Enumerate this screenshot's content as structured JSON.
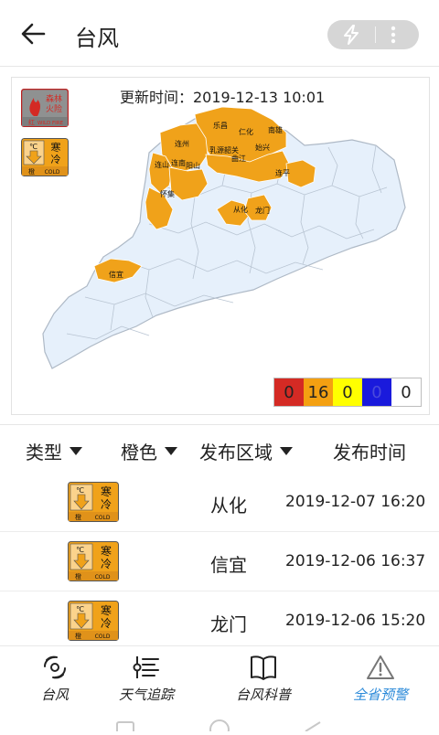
{
  "header": {
    "title": "台风"
  },
  "map": {
    "update_label": "更新时间：2019-12-13 10:01",
    "fire_badge": {
      "line1": "森林",
      "line2": "火险",
      "foot_left": "红",
      "foot_right": "WILD FIRE"
    },
    "cold_badge": {
      "unit": "℃",
      "line1": "寒",
      "line2": "冷",
      "foot_left": "橙",
      "foot_right": "COLD"
    },
    "place_labels": [
      "乐昌",
      "仁化",
      "南雄",
      "连州",
      "乳源韶关",
      "始兴",
      "曲江",
      "连山",
      "连南",
      "阳山",
      "连平",
      "怀集",
      "从化",
      "龙门",
      "信宜"
    ],
    "legend": [
      {
        "value": "0",
        "color": "#d42a24",
        "text_color": "#222222"
      },
      {
        "value": "16",
        "color": "#f4a011",
        "text_color": "#222222"
      },
      {
        "value": "0",
        "color": "#ffff00",
        "text_color": "#222222"
      },
      {
        "value": "0",
        "color": "#1a1adc",
        "text_color": "#4a4adc"
      },
      {
        "value": "0",
        "color": "#ffffff",
        "text_color": "#222222"
      }
    ],
    "colors": {
      "land": "#e6f0fb",
      "border": "#aeb9c6",
      "warning": "#f0a21a"
    }
  },
  "table": {
    "headers": [
      {
        "label": "类型",
        "has_dropdown": true
      },
      {
        "label": "橙色",
        "has_dropdown": true
      },
      {
        "label": "发布区域",
        "has_dropdown": true
      },
      {
        "label": "发布时间",
        "has_dropdown": false
      }
    ],
    "rows": [
      {
        "area": "从化",
        "time": "2019-12-07 16:20"
      },
      {
        "area": "信宜",
        "time": "2019-12-06 16:37"
      },
      {
        "area": "龙门",
        "time": "2019-12-06 15:20"
      }
    ]
  },
  "nav": {
    "items": [
      {
        "label": "台风",
        "icon": "typhoon-icon",
        "active": false
      },
      {
        "label": "天气追踪",
        "icon": "tracking-list-icon",
        "active": false
      },
      {
        "label": "台风科普",
        "icon": "book-icon",
        "active": false
      },
      {
        "label": "全省预警",
        "icon": "warning-icon",
        "active": true
      }
    ],
    "active_color": "#2b8ad9"
  }
}
